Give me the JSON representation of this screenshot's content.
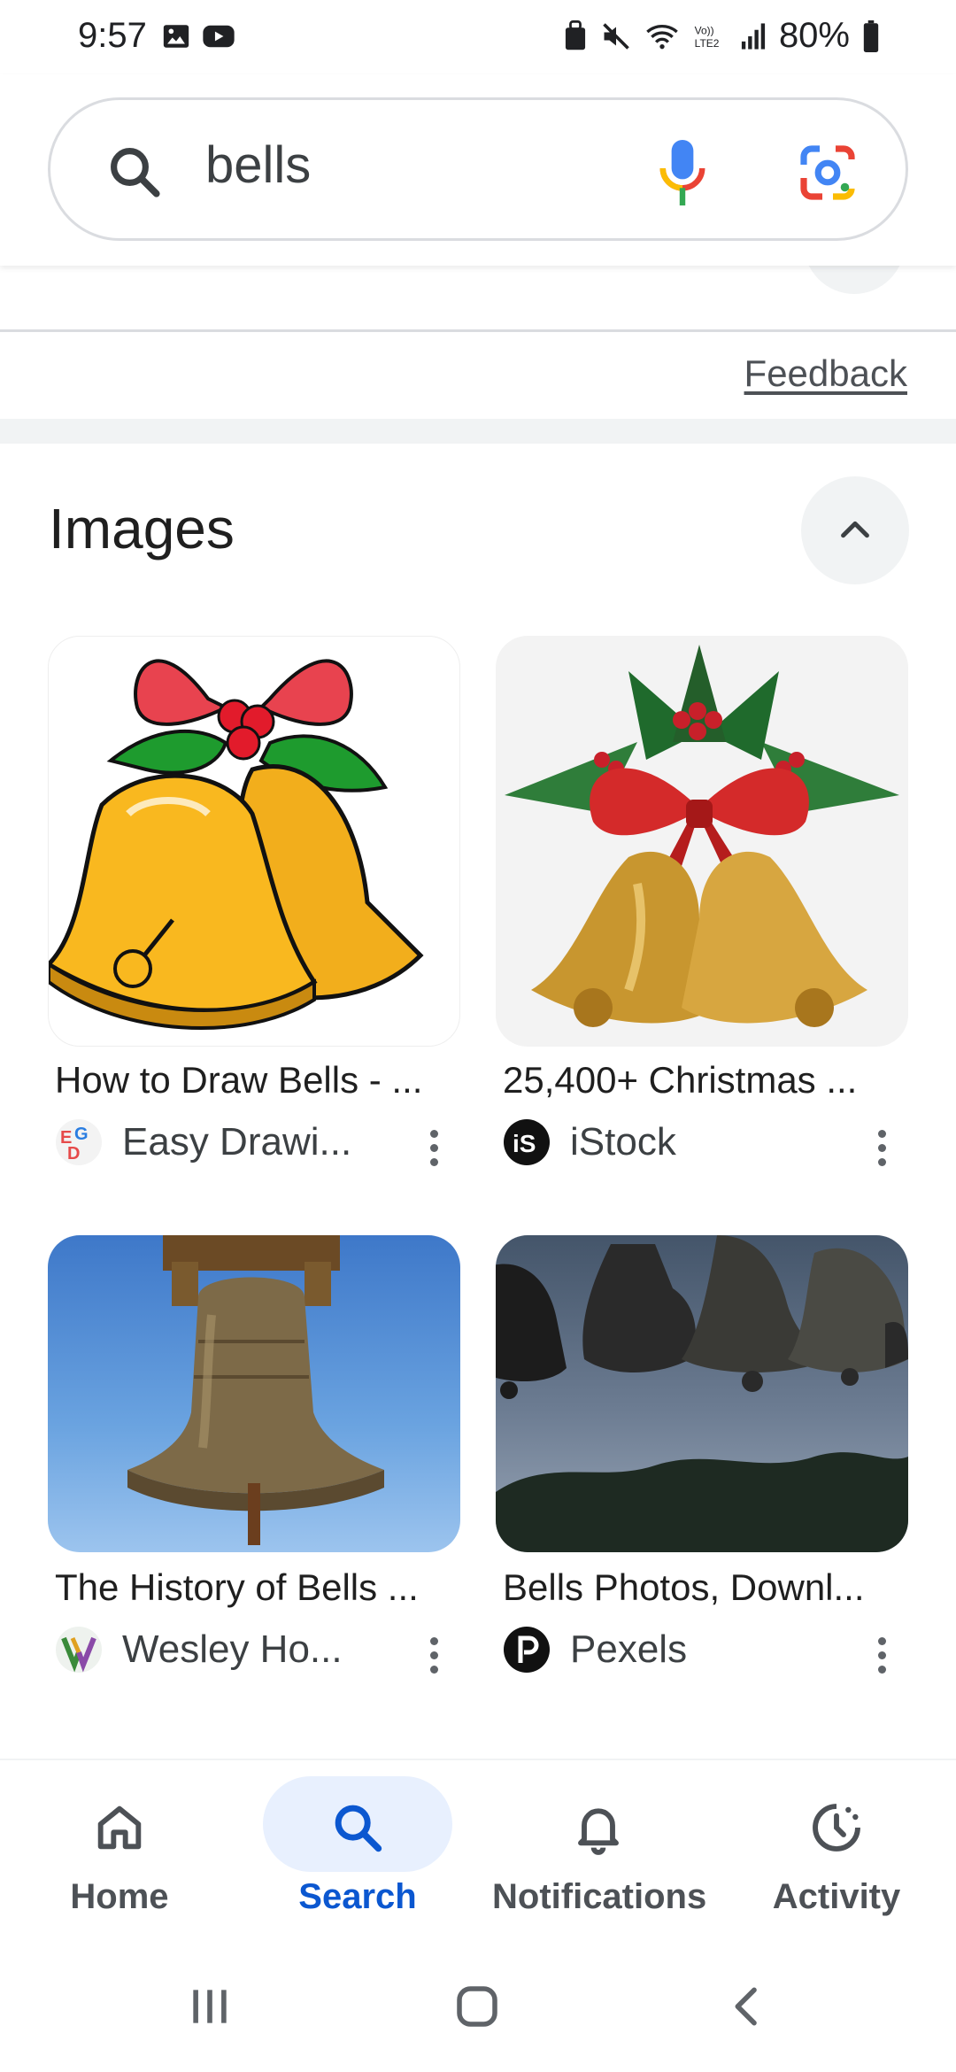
{
  "status_bar": {
    "time": "9:57",
    "battery": "80%"
  },
  "search": {
    "query": "bells"
  },
  "feedback": {
    "label": "Feedback"
  },
  "images_section": {
    "title": "Images",
    "items": [
      {
        "title": "How to Draw Bells - ...",
        "source": "Easy Drawi..."
      },
      {
        "title": "25,400+ Christmas ...",
        "source": "iStock"
      },
      {
        "title": "The History of Bells ...",
        "source": "Wesley Ho..."
      },
      {
        "title": "Bells Photos, Downl...",
        "source": "Pexels"
      }
    ]
  },
  "bottom_nav": {
    "items": [
      {
        "label": "Home",
        "icon": "home-icon"
      },
      {
        "label": "Search",
        "icon": "search-icon",
        "active": true
      },
      {
        "label": "Notifications",
        "icon": "bell-icon"
      },
      {
        "label": "Activity",
        "icon": "activity-icon"
      }
    ]
  },
  "colors": {
    "accent": "#0b57d0",
    "active_pill": "#e8f0fe",
    "text_primary": "#1f1f1f",
    "text_secondary": "#4d5156"
  }
}
